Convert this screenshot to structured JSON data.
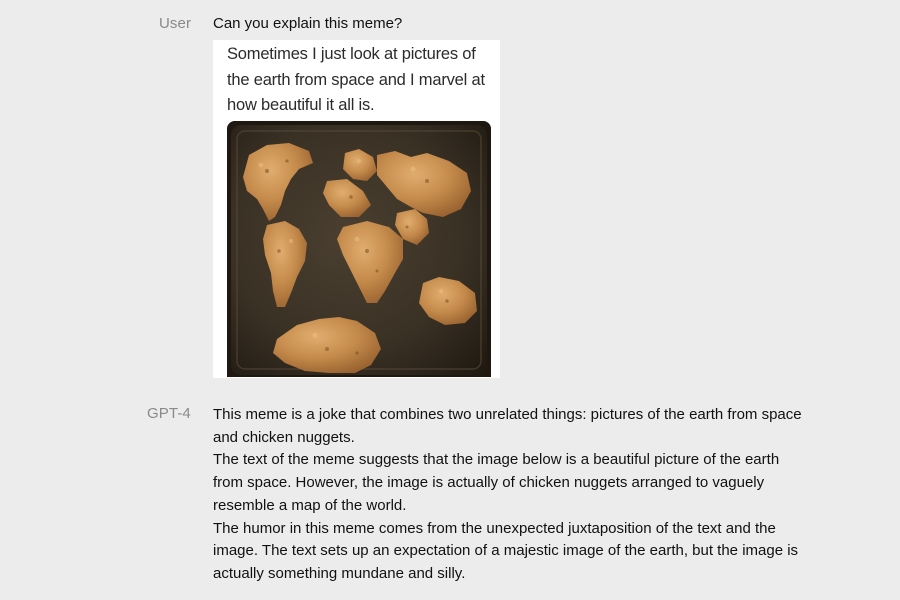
{
  "conversation": {
    "user": {
      "role_label": "User",
      "prompt": "Can you explain this meme?",
      "attachment": {
        "caption": "Sometimes I just look at pictures of the earth from space and I marvel at how beautiful it all is.",
        "photo_subject": "chicken nuggets on a baking tray arranged like a world map"
      }
    },
    "assistant": {
      "role_label": "GPT-4",
      "paragraphs": [
        "This meme is a joke that combines two unrelated things: pictures of the earth from space and chicken nuggets.",
        "The text of the meme suggests that the image below is a beautiful picture of the earth from space. However, the image is actually of chicken nuggets arranged to vaguely resemble a map of the world.",
        "The humor in this meme comes from the unexpected juxtaposition of the text and the image. The text sets up an expectation of a majestic image of the earth, but the image is actually something mundane and silly."
      ]
    }
  },
  "colors": {
    "background": "#ececec",
    "role_label": "#8a8a8a",
    "text": "#111111",
    "tray": "#3b3226",
    "nugget": "#c48a4b"
  }
}
